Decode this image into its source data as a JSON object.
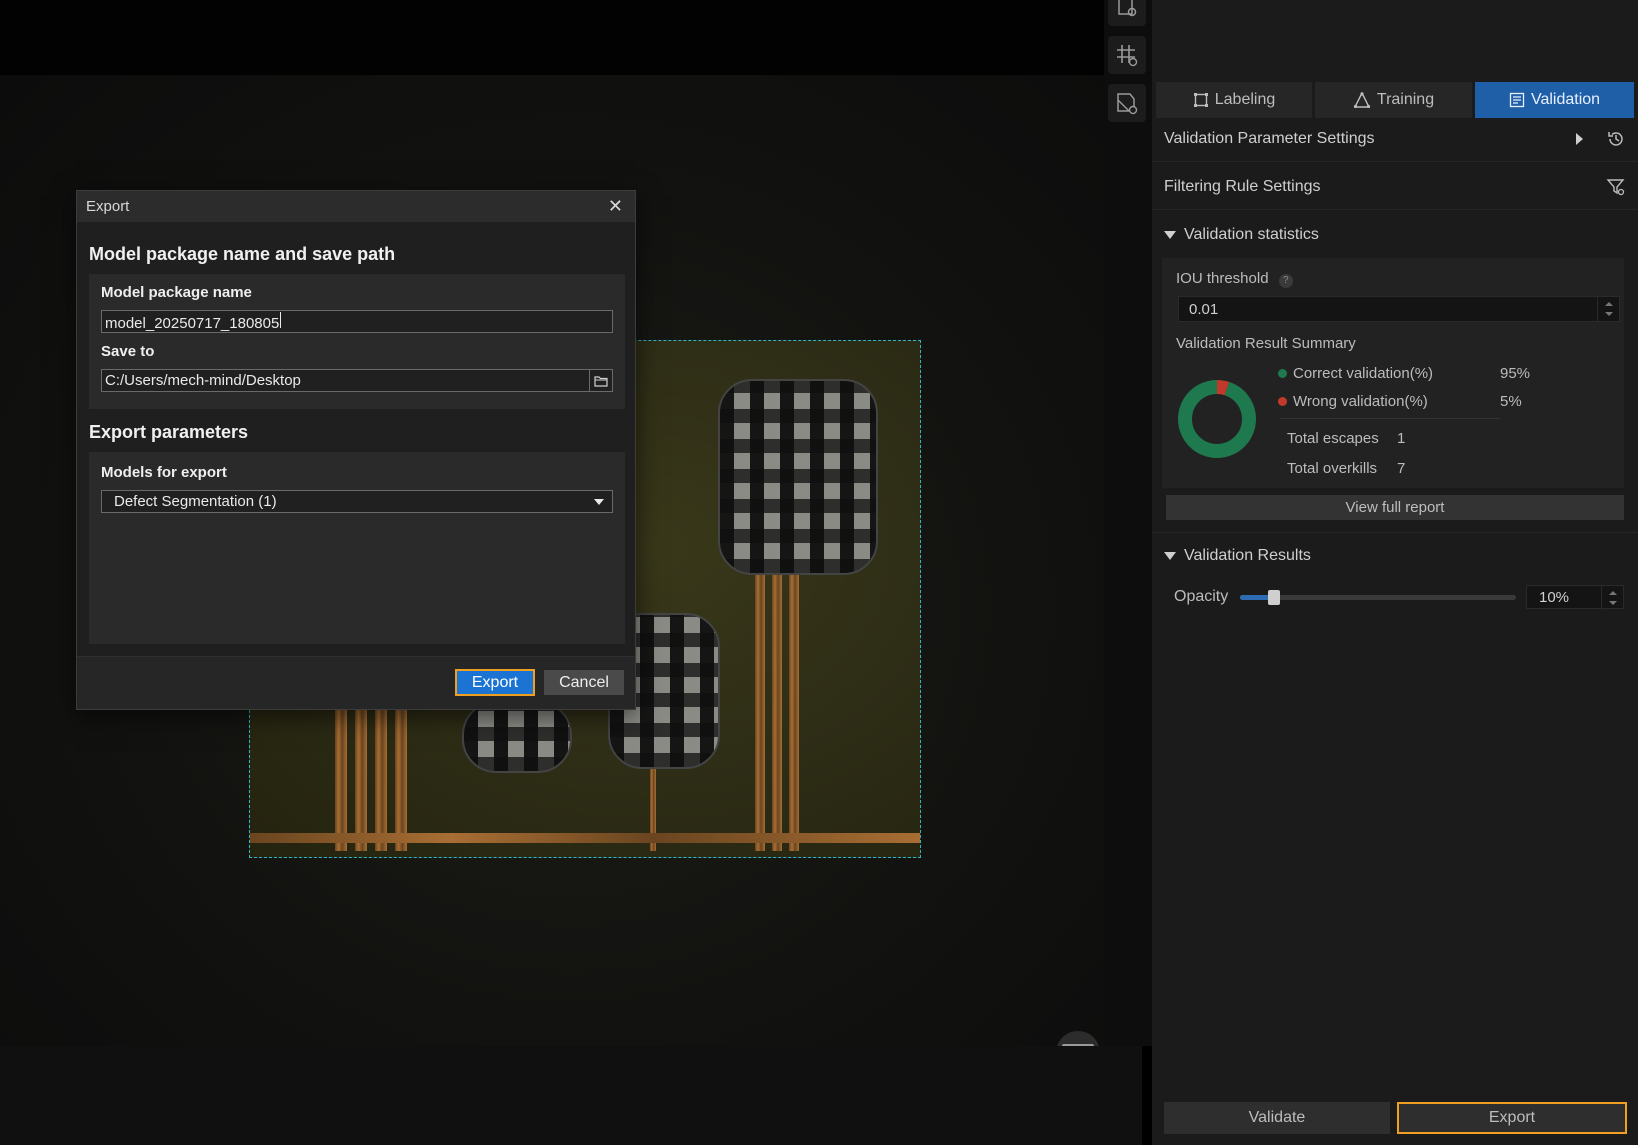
{
  "tabs": [
    {
      "label": "Labeling",
      "icon": "labeling-icon",
      "active": false
    },
    {
      "label": "Training",
      "icon": "training-icon",
      "active": false
    },
    {
      "label": "Validation",
      "icon": "validation-icon",
      "active": true
    }
  ],
  "panel": {
    "validation_param_settings": "Validation Parameter Settings",
    "filtering_rule_settings": "Filtering Rule Settings",
    "validation_statistics": "Validation statistics",
    "iou_threshold_label": "IOU threshold",
    "iou_threshold_value": "0.01",
    "result_summary_label": "Validation Result Summary",
    "correct_label": "Correct validation(%)",
    "correct_value": "95%",
    "wrong_label": "Wrong validation(%)",
    "wrong_value": "5%",
    "escapes_label": "Total escapes",
    "escapes_value": "1",
    "overkills_label": "Total overkills",
    "overkills_value": "7",
    "view_full_report": "View full report",
    "validation_results": "Validation Results",
    "opacity_label": "Opacity",
    "opacity_value": "10%",
    "opacity_fraction": 0.1,
    "validate_button": "Validate",
    "export_button": "Export",
    "donut": {
      "correct_pct": 95,
      "wrong_pct": 5,
      "correct_color": "#1e7a4e",
      "wrong_color": "#c0392b"
    }
  },
  "dialog": {
    "title": "Export",
    "section1_heading": "Model package name and save path",
    "package_name_label": "Model package name",
    "package_name_value": "model_20250717_180805",
    "save_to_label": "Save to",
    "save_to_value": "C:/Users/mech-mind/Desktop",
    "section2_heading": "Export parameters",
    "models_label": "Models for export",
    "models_value": "Defect Segmentation (1)",
    "export_button": "Export",
    "cancel_button": "Cancel"
  },
  "colors": {
    "accent": "#1f5fa8",
    "highlight": "#f0a020",
    "roi_border": "#2bb7c8"
  }
}
